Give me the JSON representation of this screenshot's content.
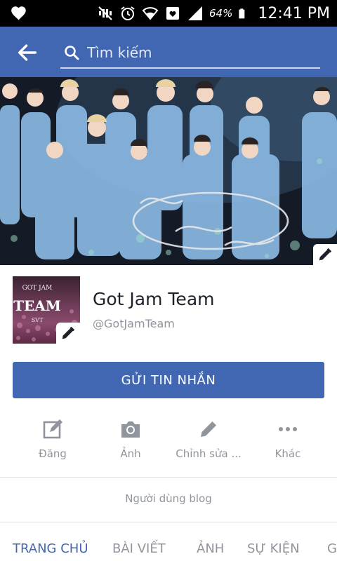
{
  "status_bar": {
    "battery_percent": "64%",
    "time": "12:41 PM",
    "icons": [
      "heart-icon",
      "mute-icon",
      "alarm-icon",
      "wifi-icon",
      "notification-icon",
      "signal-icon",
      "battery-icon"
    ]
  },
  "app_bar": {
    "back_icon": "arrow-left-icon",
    "search_placeholder": "Tìm kiếm",
    "color": "#4267b2"
  },
  "cover": {
    "edit_icon": "pencil-icon"
  },
  "profile": {
    "picture_lines": [
      "GOT JAM",
      "TEAM",
      "SVT"
    ],
    "name": "Got Jam Team",
    "handle": "@GotJamTeam",
    "edit_icon": "pencil-icon"
  },
  "message_button": {
    "label": "GỬI TIN NHẮN"
  },
  "actions": [
    {
      "label": "Đăng",
      "icon": "compose-icon"
    },
    {
      "label": "Ảnh",
      "icon": "camera-icon"
    },
    {
      "label": "Chỉnh sửa ...",
      "icon": "pencil-icon"
    },
    {
      "label": "Khác",
      "icon": "more-icon"
    }
  ],
  "category": "Người dùng blog",
  "tabs": [
    {
      "label": "TRANG CHỦ",
      "active": true
    },
    {
      "label": "BÀI VIẾT",
      "active": false
    },
    {
      "label": "ẢNH",
      "active": false
    },
    {
      "label": "SỰ KIỆN",
      "active": false
    },
    {
      "label": "G",
      "active": false
    }
  ]
}
